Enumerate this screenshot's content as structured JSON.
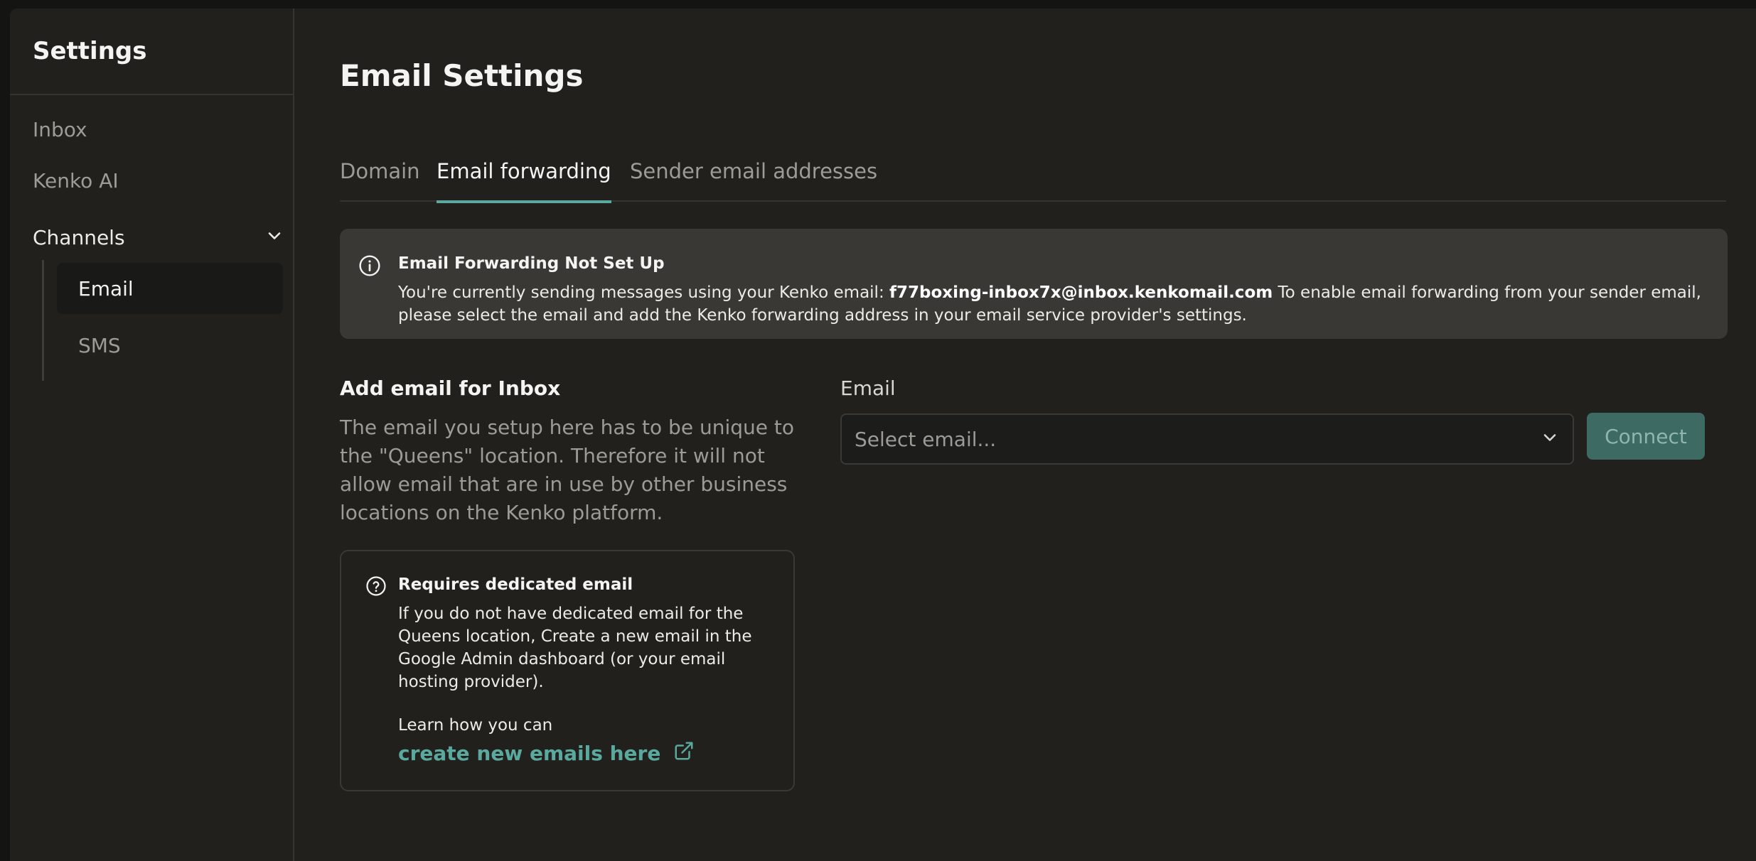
{
  "sidebar": {
    "title": "Settings",
    "items": [
      "Inbox",
      "Kenko AI"
    ],
    "channels_label": "Channels",
    "channels_sub": [
      "Email",
      "SMS"
    ]
  },
  "main": {
    "title": "Email Settings",
    "tabs": [
      "Domain",
      "Email forwarding",
      "Sender email addresses"
    ],
    "active_tab": "Email forwarding",
    "alert": {
      "title": "Email Forwarding Not Set Up",
      "body_prefix": "You're currently sending messages using your Kenko email: ",
      "email": "f77boxing-inbox7x@inbox.kenkomail.com",
      "body_suffix": " To enable email forwarding from your sender email, please select the email and add the Kenko forwarding address in your email service provider's settings."
    },
    "section": {
      "title": "Add email for Inbox",
      "description": "The email you setup here has to be unique to the \"Queens\" location. Therefore it will not allow email that are in use by other business locations on the Kenko platform."
    },
    "info_card": {
      "title": "Requires dedicated email",
      "body": "If you do not have dedicated email for the Queens location, Create a new email in the Google Admin dashboard (or your email hosting provider).",
      "learn": "Learn how you can",
      "link": "create new emails here"
    },
    "email_field": {
      "label": "Email",
      "placeholder": "Select email..."
    },
    "connect_label": "Connect"
  },
  "colors": {
    "accent": "#5aa99e",
    "button": "#3d6a63",
    "background": "#21201d",
    "alert_bg": "#3a3835"
  }
}
